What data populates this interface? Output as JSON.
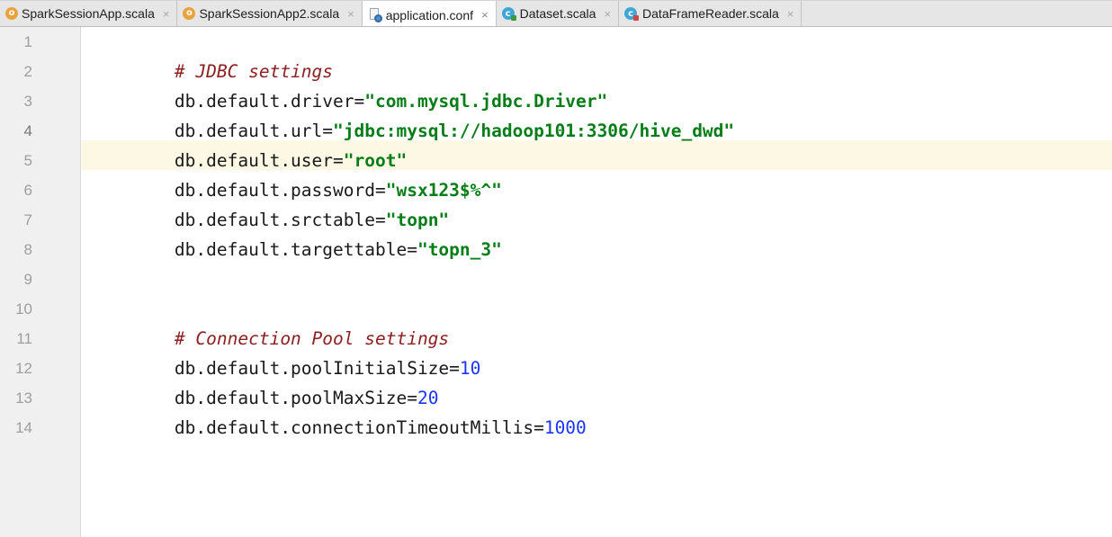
{
  "tabs": [
    {
      "label": "SparkSessionApp.scala",
      "icon": "scala-object-icon",
      "active": false
    },
    {
      "label": "SparkSessionApp2.scala",
      "icon": "scala-object-icon",
      "active": false
    },
    {
      "label": "application.conf",
      "icon": "config-file-icon",
      "active": true
    },
    {
      "label": "Dataset.scala",
      "icon": "scala-class-icon",
      "active": false
    },
    {
      "label": "DataFrameReader.scala",
      "icon": "scala-class-icon",
      "active": false
    }
  ],
  "tab_close_glyph": "×",
  "icon_letters": {
    "object": "o",
    "class": "c"
  },
  "editor": {
    "current_line": 4,
    "line_numbers": [
      "1",
      "2",
      "3",
      "4",
      "5",
      "6",
      "7",
      "8",
      "9",
      "10",
      "11",
      "12",
      "13",
      "14"
    ],
    "lines": [
      {
        "comment": "# JDBC settings"
      },
      {
        "key": "db.default.driver=",
        "string": "\"com.mysql.jdbc.Driver\""
      },
      {
        "key": "db.default.url=",
        "string": "\"jdbc:mysql://hadoop101:3306/hive_dwd\""
      },
      {
        "key": "db.default.user=",
        "string": "\"root\""
      },
      {
        "key": "db.default.password=",
        "string": "\"wsx123$%^\""
      },
      {
        "key": "db.default.srctable=",
        "string": "\"topn\""
      },
      {
        "key": "db.default.targettable=",
        "string": "\"topn_3\""
      },
      {},
      {},
      {
        "comment": "# Connection Pool settings"
      },
      {
        "key": "db.default.poolInitialSize=",
        "number": "10"
      },
      {
        "key": "db.default.poolMaxSize=",
        "number": "20"
      },
      {
        "key": "db.default.connectionTimeoutMillis=",
        "number": "1000"
      },
      {}
    ]
  },
  "colors": {
    "comment": "#8c1f1f",
    "string": "#067d17",
    "number": "#1a34ff",
    "current_line_bg": "#fdf8e3",
    "gutter_bg": "#f0f0f0"
  }
}
